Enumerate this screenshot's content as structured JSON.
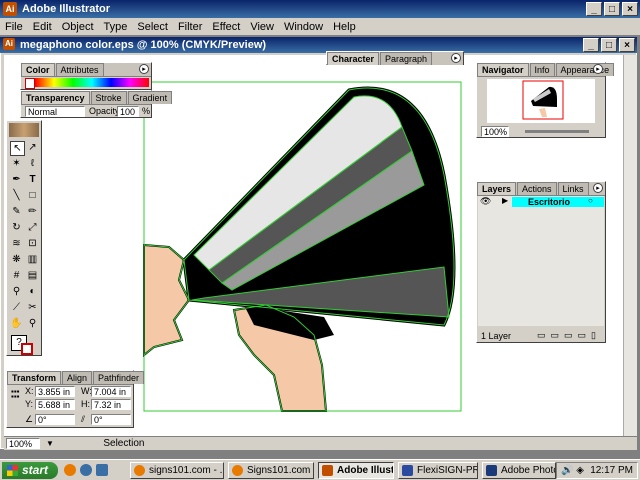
{
  "app": {
    "title": "Adobe Illustrator"
  },
  "menu": [
    "File",
    "Edit",
    "Object",
    "Type",
    "Select",
    "Filter",
    "Effect",
    "View",
    "Window",
    "Help"
  ],
  "document": {
    "title": "megaphono color.eps @ 100% (CMYK/Preview)",
    "zoom": "100%",
    "status": "Selection"
  },
  "color_panel": {
    "tabs": [
      "Color",
      "Attributes"
    ]
  },
  "transparency_panel": {
    "tabs": [
      "Transparency",
      "Stroke",
      "Gradient"
    ],
    "mode": "Normal",
    "opacity_label": "Opacity:",
    "opacity_value": "100",
    "opacity_unit": "%"
  },
  "character_panel": {
    "tabs": [
      "Character",
      "Paragraph"
    ]
  },
  "navigator_panel": {
    "tabs": [
      "Navigator",
      "Info",
      "Appearance"
    ],
    "zoom": "100%"
  },
  "layers_panel": {
    "tabs": [
      "Layers",
      "Actions",
      "Links"
    ],
    "layer_name": "Escritorio",
    "count": "1 Layer"
  },
  "transform_panel": {
    "tabs": [
      "Transform",
      "Align",
      "Pathfinder"
    ],
    "x_label": "X:",
    "x": "3.855 in",
    "y_label": "Y:",
    "y": "5.688 in",
    "w_label": "W:",
    "w": "7.004 in",
    "h_label": "H:",
    "h": "7.32 in",
    "rotate": "0°",
    "shear": "0°"
  },
  "taskbar": {
    "start": "start",
    "buttons": [
      "signs101.com - ...",
      "Signs101.com - ...",
      "Adobe Illustrator",
      "FlexiSIGN-PRO ...",
      "Adobe Photoshop"
    ],
    "clock": "12:17 PM"
  },
  "colors": {
    "selection": "#33cc33",
    "skin": "#f5c8a8",
    "cyan_layer": "#00ffff",
    "title_blue": "#0a246a"
  }
}
